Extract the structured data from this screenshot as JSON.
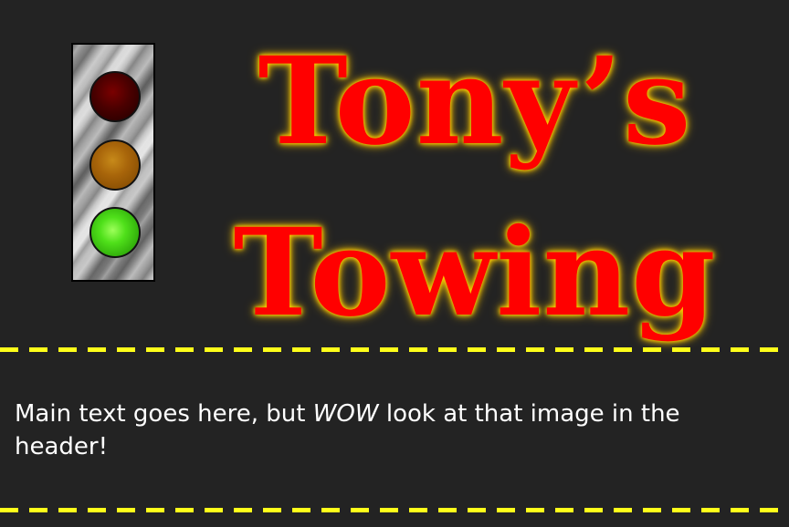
{
  "header": {
    "title_line1": "Tony’s",
    "title_line2": "Towing",
    "traffic_light": {
      "lamps": [
        {
          "name": "red",
          "lit": false
        },
        {
          "name": "amber",
          "lit": false
        },
        {
          "name": "green",
          "lit": true
        }
      ]
    }
  },
  "main": {
    "text_before": "Main text goes here, but ",
    "text_emphasis": "WOW",
    "text_after": " look at that image in the header!"
  },
  "colors": {
    "background": "#232323",
    "title": "#ff0000",
    "title_glow": "#ffd400",
    "divider": "#ffff1a",
    "body_text": "#ffffff"
  }
}
